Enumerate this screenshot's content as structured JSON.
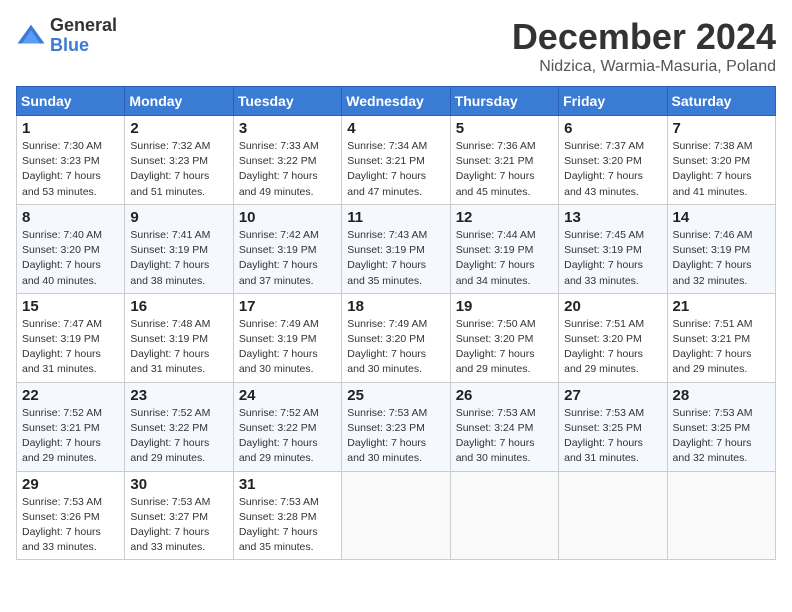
{
  "logo": {
    "general": "General",
    "blue": "Blue"
  },
  "title": "December 2024",
  "subtitle": "Nidzica, Warmia-Masuria, Poland",
  "days_header": [
    "Sunday",
    "Monday",
    "Tuesday",
    "Wednesday",
    "Thursday",
    "Friday",
    "Saturday"
  ],
  "weeks": [
    [
      {
        "day": "1",
        "sunrise": "7:30 AM",
        "sunset": "3:23 PM",
        "daylight": "7 hours and 53 minutes."
      },
      {
        "day": "2",
        "sunrise": "7:32 AM",
        "sunset": "3:23 PM",
        "daylight": "7 hours and 51 minutes."
      },
      {
        "day": "3",
        "sunrise": "7:33 AM",
        "sunset": "3:22 PM",
        "daylight": "7 hours and 49 minutes."
      },
      {
        "day": "4",
        "sunrise": "7:34 AM",
        "sunset": "3:21 PM",
        "daylight": "7 hours and 47 minutes."
      },
      {
        "day": "5",
        "sunrise": "7:36 AM",
        "sunset": "3:21 PM",
        "daylight": "7 hours and 45 minutes."
      },
      {
        "day": "6",
        "sunrise": "7:37 AM",
        "sunset": "3:20 PM",
        "daylight": "7 hours and 43 minutes."
      },
      {
        "day": "7",
        "sunrise": "7:38 AM",
        "sunset": "3:20 PM",
        "daylight": "7 hours and 41 minutes."
      }
    ],
    [
      {
        "day": "8",
        "sunrise": "7:40 AM",
        "sunset": "3:20 PM",
        "daylight": "7 hours and 40 minutes."
      },
      {
        "day": "9",
        "sunrise": "7:41 AM",
        "sunset": "3:19 PM",
        "daylight": "7 hours and 38 minutes."
      },
      {
        "day": "10",
        "sunrise": "7:42 AM",
        "sunset": "3:19 PM",
        "daylight": "7 hours and 37 minutes."
      },
      {
        "day": "11",
        "sunrise": "7:43 AM",
        "sunset": "3:19 PM",
        "daylight": "7 hours and 35 minutes."
      },
      {
        "day": "12",
        "sunrise": "7:44 AM",
        "sunset": "3:19 PM",
        "daylight": "7 hours and 34 minutes."
      },
      {
        "day": "13",
        "sunrise": "7:45 AM",
        "sunset": "3:19 PM",
        "daylight": "7 hours and 33 minutes."
      },
      {
        "day": "14",
        "sunrise": "7:46 AM",
        "sunset": "3:19 PM",
        "daylight": "7 hours and 32 minutes."
      }
    ],
    [
      {
        "day": "15",
        "sunrise": "7:47 AM",
        "sunset": "3:19 PM",
        "daylight": "7 hours and 31 minutes."
      },
      {
        "day": "16",
        "sunrise": "7:48 AM",
        "sunset": "3:19 PM",
        "daylight": "7 hours and 31 minutes."
      },
      {
        "day": "17",
        "sunrise": "7:49 AM",
        "sunset": "3:19 PM",
        "daylight": "7 hours and 30 minutes."
      },
      {
        "day": "18",
        "sunrise": "7:49 AM",
        "sunset": "3:20 PM",
        "daylight": "7 hours and 30 minutes."
      },
      {
        "day": "19",
        "sunrise": "7:50 AM",
        "sunset": "3:20 PM",
        "daylight": "7 hours and 29 minutes."
      },
      {
        "day": "20",
        "sunrise": "7:51 AM",
        "sunset": "3:20 PM",
        "daylight": "7 hours and 29 minutes."
      },
      {
        "day": "21",
        "sunrise": "7:51 AM",
        "sunset": "3:21 PM",
        "daylight": "7 hours and 29 minutes."
      }
    ],
    [
      {
        "day": "22",
        "sunrise": "7:52 AM",
        "sunset": "3:21 PM",
        "daylight": "7 hours and 29 minutes."
      },
      {
        "day": "23",
        "sunrise": "7:52 AM",
        "sunset": "3:22 PM",
        "daylight": "7 hours and 29 minutes."
      },
      {
        "day": "24",
        "sunrise": "7:52 AM",
        "sunset": "3:22 PM",
        "daylight": "7 hours and 29 minutes."
      },
      {
        "day": "25",
        "sunrise": "7:53 AM",
        "sunset": "3:23 PM",
        "daylight": "7 hours and 30 minutes."
      },
      {
        "day": "26",
        "sunrise": "7:53 AM",
        "sunset": "3:24 PM",
        "daylight": "7 hours and 30 minutes."
      },
      {
        "day": "27",
        "sunrise": "7:53 AM",
        "sunset": "3:25 PM",
        "daylight": "7 hours and 31 minutes."
      },
      {
        "day": "28",
        "sunrise": "7:53 AM",
        "sunset": "3:25 PM",
        "daylight": "7 hours and 32 minutes."
      }
    ],
    [
      {
        "day": "29",
        "sunrise": "7:53 AM",
        "sunset": "3:26 PM",
        "daylight": "7 hours and 33 minutes."
      },
      {
        "day": "30",
        "sunrise": "7:53 AM",
        "sunset": "3:27 PM",
        "daylight": "7 hours and 33 minutes."
      },
      {
        "day": "31",
        "sunrise": "7:53 AM",
        "sunset": "3:28 PM",
        "daylight": "7 hours and 35 minutes."
      },
      null,
      null,
      null,
      null
    ]
  ]
}
